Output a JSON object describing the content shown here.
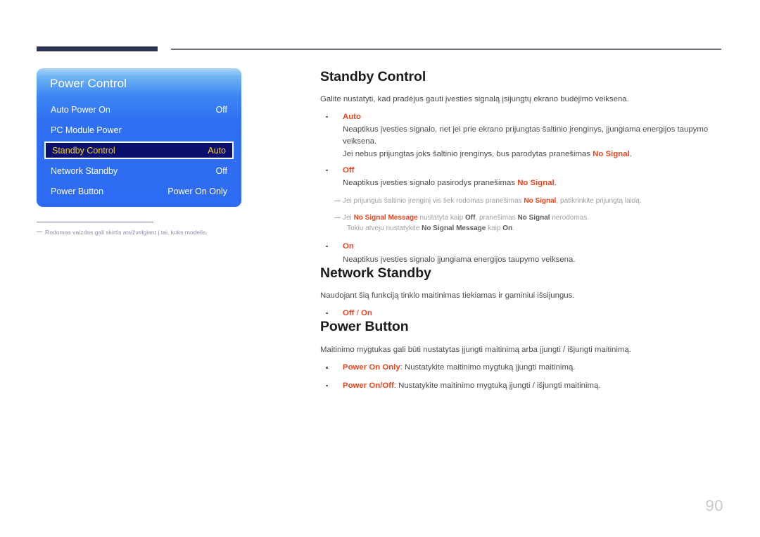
{
  "page": {
    "number": "90",
    "language": "lt"
  },
  "osd": {
    "title": "Power Control",
    "rows": [
      {
        "label": "Auto Power On",
        "value": "Off",
        "selected": false
      },
      {
        "label": "PC Module Power",
        "value": "",
        "selected": false
      },
      {
        "label": "Standby Control",
        "value": "Auto",
        "selected": true
      },
      {
        "label": "Network Standby",
        "value": "Off",
        "selected": false
      },
      {
        "label": "Power Button",
        "value": "Power On Only",
        "selected": false
      }
    ],
    "footnote": "Rodomas vaizdas gali skirtis atsižvelgiant į tai, koks modelis."
  },
  "sections": {
    "standby_control": {
      "heading": "Standby Control",
      "intro": "Galite nustatyti, kad pradėjus gauti įvesties signalą įsijungtų ekrano budėjimo veiksena.",
      "items": {
        "auto": {
          "term": "Auto",
          "line1": "Neaptikus įvesties signalo, net jei prie ekrano prijungtas šaltinio įrenginys, įjungiama energijos taupymo veiksena.",
          "line2_a": "Jei nebus prijungtas joks šaltinio įrenginys, bus parodytas pranešimas ",
          "line2_kw": "No Signal",
          "line2_b": "."
        },
        "off": {
          "term": "Off",
          "line1_a": "Neaptikus įvesties signalo pasirodys pranešimas ",
          "line1_kw": "No Signal",
          "line1_b": "."
        },
        "on": {
          "term": "On",
          "line1": "Neaptikus įvesties signalo įjungiama energijos taupymo veiksena."
        }
      },
      "notes": {
        "note1_a": "Jei prijungus šaltinio įrenginį vis tiek rodomas pranešimas ",
        "note1_kw": "No Signal",
        "note1_b": ", patikrinkite prijungtą laidą.",
        "note2_a": "Jei ",
        "note2_kw1": "No Signal Message",
        "note2_b": " nustatyta kaip ",
        "note2_kw2": "Off",
        "note2_c": ", pranešimas ",
        "note2_kw3": "No Signal",
        "note2_d": " nerodomas.",
        "note2_cont_a": "Tokiu atveju nustatykite ",
        "note2_cont_kw": "No Signal Message",
        "note2_cont_b": " kaip ",
        "note2_cont_kw2": "On",
        "note2_cont_c": "."
      }
    },
    "network_standby": {
      "heading": "Network Standby",
      "intro": "Naudojant šią funkciją tinklo maitinimas tiekiamas ir gaminiui išsijungus.",
      "option_off": "Off",
      "option_sep": " / ",
      "option_on": "On"
    },
    "power_button": {
      "heading": "Power Button",
      "intro": "Maitinimo mygtukas gali būti nustatytas įjungti maitinimą arba įjungti / išjungti maitinimą.",
      "items": [
        {
          "term": "Power On Only",
          "desc": ": Nustatykite maitinimo mygtuką įjungti maitinimą."
        },
        {
          "term": "Power On/Off",
          "desc": ": Nustatykite maitinimo mygtuką įjungti / išjungti maitinimą."
        }
      ]
    }
  },
  "colors": {
    "accent_red": "#e8451f",
    "osd_blue": "#2d6bf2",
    "osd_selected_bg": "#0a0f6e",
    "osd_selected_text": "#ffd21e",
    "header_bar": "#2e3352"
  }
}
